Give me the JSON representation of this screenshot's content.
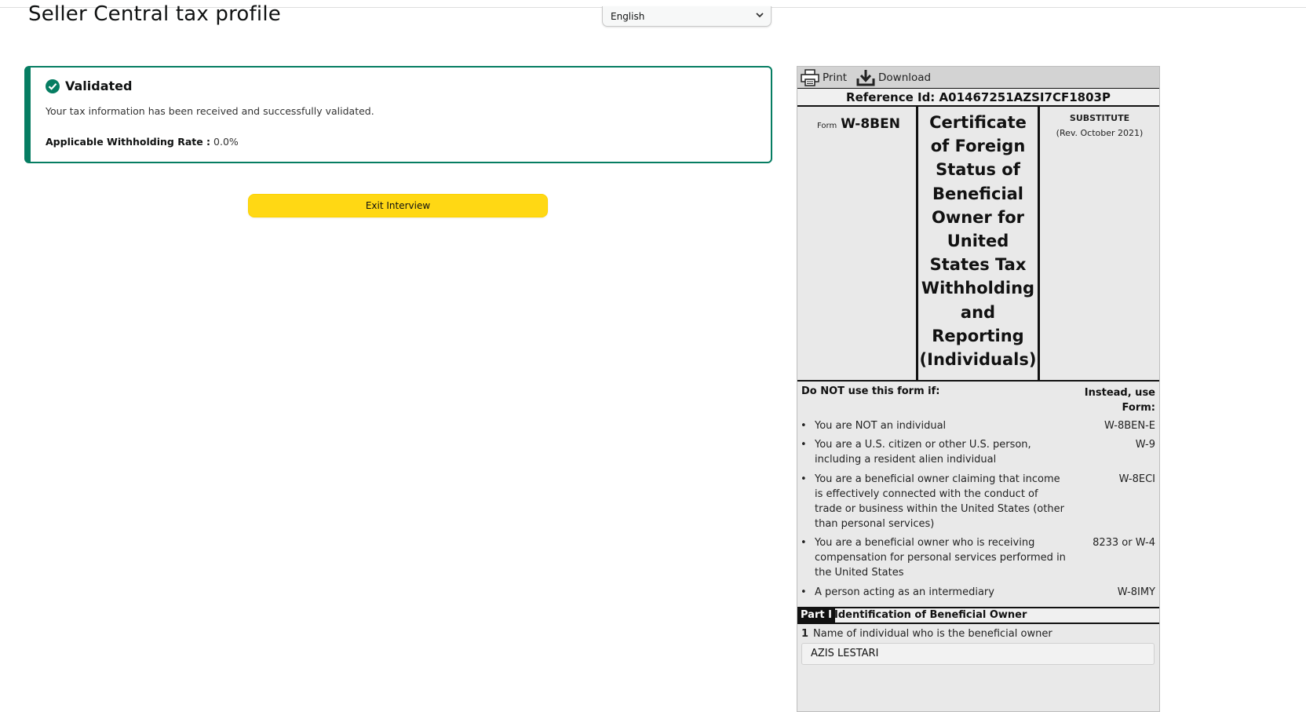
{
  "page": {
    "title": "Seller Central tax profile",
    "language": "English"
  },
  "alert": {
    "heading": "Validated",
    "message": "Your tax information has been received and successfully validated.",
    "rate_label": "Applicable Withholding Rate :",
    "rate_value": "0.0%",
    "color": "#067d62"
  },
  "exit_button": {
    "label": "Exit Interview",
    "color": "#ffd814"
  },
  "form": {
    "toolbar": {
      "print": "Print",
      "download": "Download",
      "print_icon": "printer-icon",
      "download_icon": "download-icon"
    },
    "reference": "Reference Id: A01467251AZSI7CF1803P",
    "form_prefix": "Form",
    "form_name": "W-8BEN",
    "title": "Certificate of Foreign Status of Beneficial Owner for United States Tax Withholding and Reporting (Individuals)",
    "substitute": "SUBSTITUTE",
    "revision": "(Rev. October 2021)",
    "donot_heading": "Do NOT use this form if:",
    "instead_heading": "Instead, use Form:",
    "rows": [
      {
        "text": "You are NOT an individual",
        "form": "W-8BEN-E"
      },
      {
        "text": "You are a U.S. citizen or other U.S. person, including a resident alien individual",
        "form": "W-9"
      },
      {
        "text": "You are a beneficial owner claiming that income is effectively connected with the conduct of trade or business within the United States (other than personal services)",
        "form": "W-8ECI"
      },
      {
        "text": "You are a beneficial owner who is receiving compensation for personal services performed in the United States",
        "form": "8233 or W-4"
      },
      {
        "text": "A person acting as an intermediary",
        "form": "W-8IMY"
      }
    ],
    "part_tag": "Part I",
    "part_title": "Identification of Beneficial Owner",
    "q1_num": "1",
    "q1_label": "Name of individual who is the beneficial owner",
    "q1_value": "AZIS LESTARI"
  }
}
